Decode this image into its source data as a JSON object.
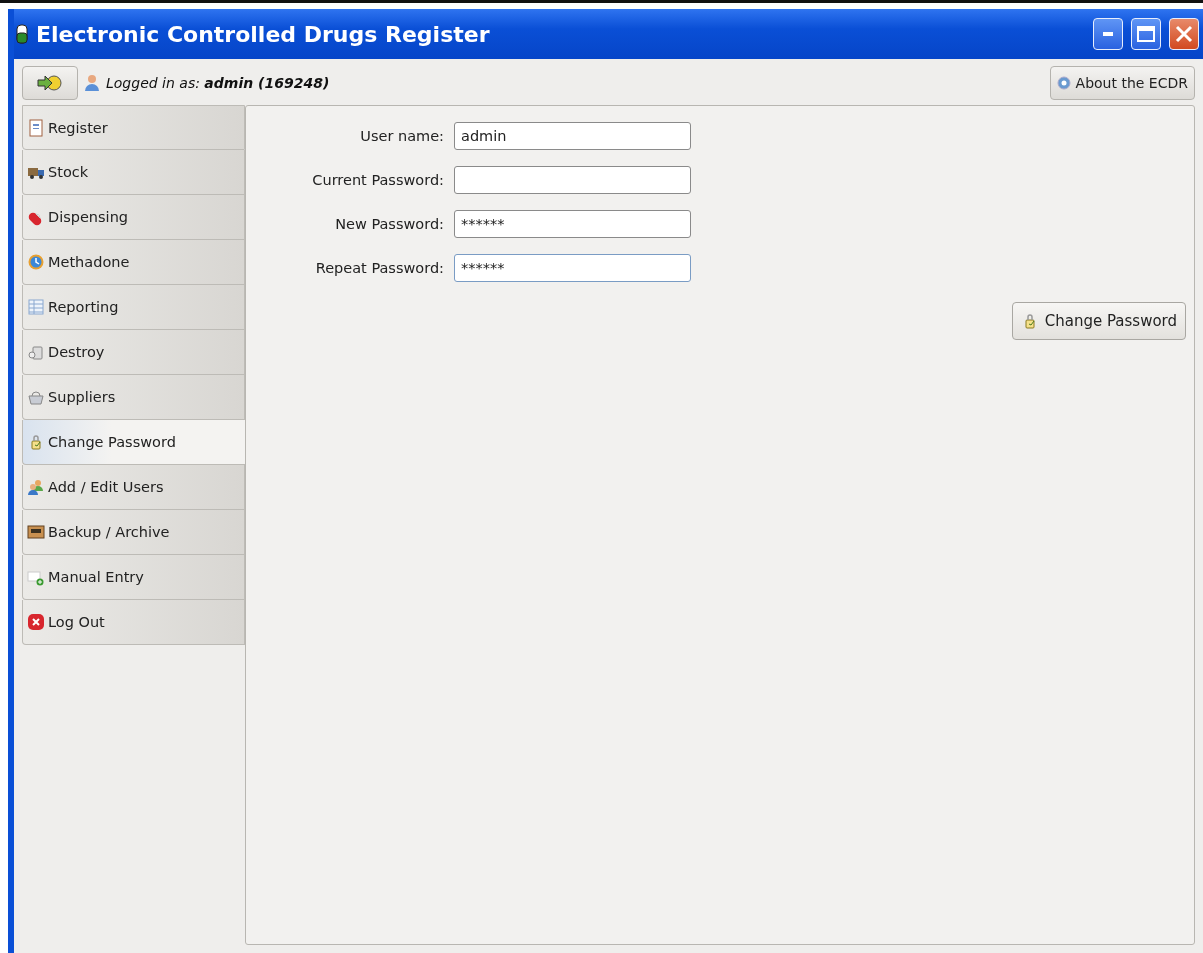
{
  "window": {
    "title": "Electronic Controlled Drugs Register"
  },
  "toolbar": {
    "login_status": "Logged in as: **admin (169248)**",
    "about_button": "About the ECDR"
  },
  "sidebar": {
    "items": [
      {
        "label": "Register",
        "selected": false
      },
      {
        "label": "Stock",
        "selected": false
      },
      {
        "label": "Dispensing",
        "selected": false
      },
      {
        "label": "Methadone",
        "selected": false
      },
      {
        "label": "Reporting",
        "selected": false
      },
      {
        "label": "Destroy",
        "selected": false
      },
      {
        "label": "Suppliers",
        "selected": false
      },
      {
        "label": "Change Password",
        "selected": true
      },
      {
        "label": "Add / Edit Users",
        "selected": false
      },
      {
        "label": "Backup / Archive",
        "selected": false
      },
      {
        "label": "Manual Entry",
        "selected": false
      },
      {
        "label": "Log Out",
        "selected": false
      }
    ]
  },
  "form": {
    "fields": [
      {
        "label": "User name:",
        "value": "admin",
        "focused": false
      },
      {
        "label": "Current Password:",
        "focused": false
      },
      {
        "label": "New Password:",
        "value": "******",
        "focused": false
      },
      {
        "label": "Repeat Password:",
        "value": "******",
        "focused": true
      }
    ],
    "submit_button": "Change Password"
  }
}
